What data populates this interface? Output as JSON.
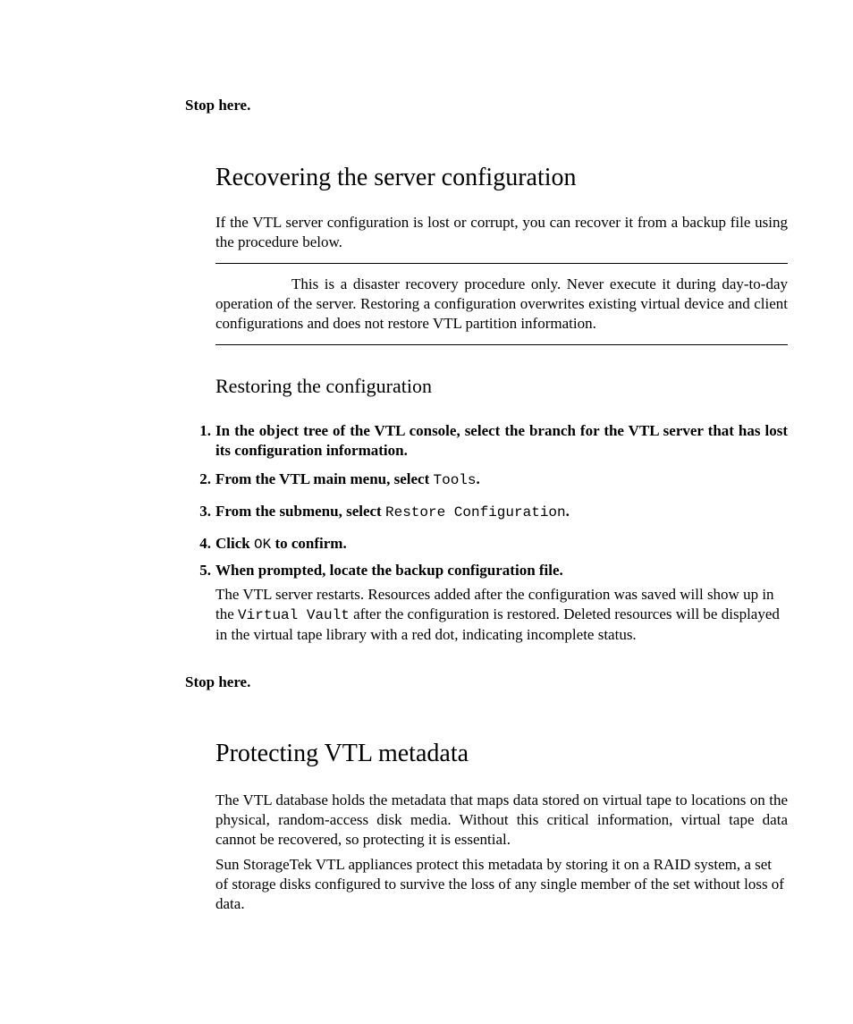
{
  "stop": "Stop here.",
  "sec1": {
    "heading": "Recovering the server configuration",
    "intro_a": "If the VTL server configuration is lost or corrupt, you can recover it from a backup file using the procedure below.",
    "callout": "This is a disaster recovery procedure only. Never execute it during day-to-day operation of the server. Restoring a configuration overwrites existing virtual device and client configurations and does not restore VTL partition information.",
    "sub": "Restoring the configuration",
    "s1_num": "1.",
    "s1": "In the object tree of the VTL console, select the branch for the VTL server that has lost its configuration information.",
    "s2_num": "2.",
    "s2_a": "From the VTL main menu, select ",
    "s2_code": "Tools",
    "s2_b": ".",
    "s3_num": "3.",
    "s3_a": "From the submenu, select ",
    "s3_code": "Restore Configuration",
    "s3_b": ".",
    "s4_num": "4.",
    "s4_a": "Click ",
    "s4_code": "OK",
    "s4_b": " to confirm.",
    "s5_num": "5.",
    "s5": "When prompted, locate the backup configuration file.",
    "s5_para_a": "The VTL server restarts. Resources added after the configuration was saved will show up in the ",
    "s5_para_code": "Virtual Vault",
    "s5_para_b": " after the configuration is restored. Deleted resources will be displayed in the virtual tape library with a red dot, indicating incomplete status."
  },
  "sec2": {
    "heading": "Protecting VTL metadata",
    "p1": "The VTL database holds the metadata that maps data stored on virtual tape to locations on the physical, random-access disk media. Without this critical information, virtual tape data cannot be recovered, so protecting it is essential.",
    "p2": "Sun StorageTek VTL appliances protect this metadata by storing it on a RAID system, a set of storage disks configured to survive the loss of any single member of the set without loss of data."
  }
}
